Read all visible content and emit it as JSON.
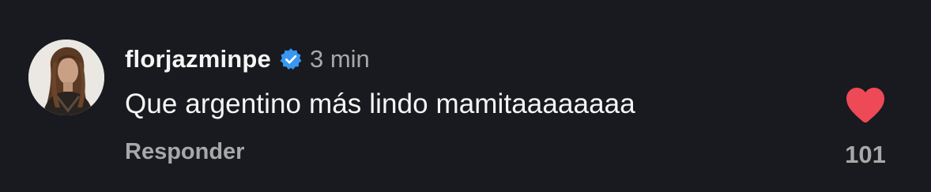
{
  "comment": {
    "author": {
      "username": "florjazminpe",
      "avatar_icon": "profile-photo",
      "verified_icon": "verified-badge-icon"
    },
    "timestamp": "3 min",
    "text": "Que argentino más lindo mamitaaaaaaaa",
    "reply_label": "Responder",
    "likes": {
      "count": "101",
      "icon": "heart-icon",
      "liked": true
    }
  },
  "colors": {
    "background": "#181a1f",
    "primary_text": "#f5f5f5",
    "secondary_text": "#a8a8a8",
    "verified_blue": "#3897f0",
    "heart_red": "#ed4956"
  }
}
